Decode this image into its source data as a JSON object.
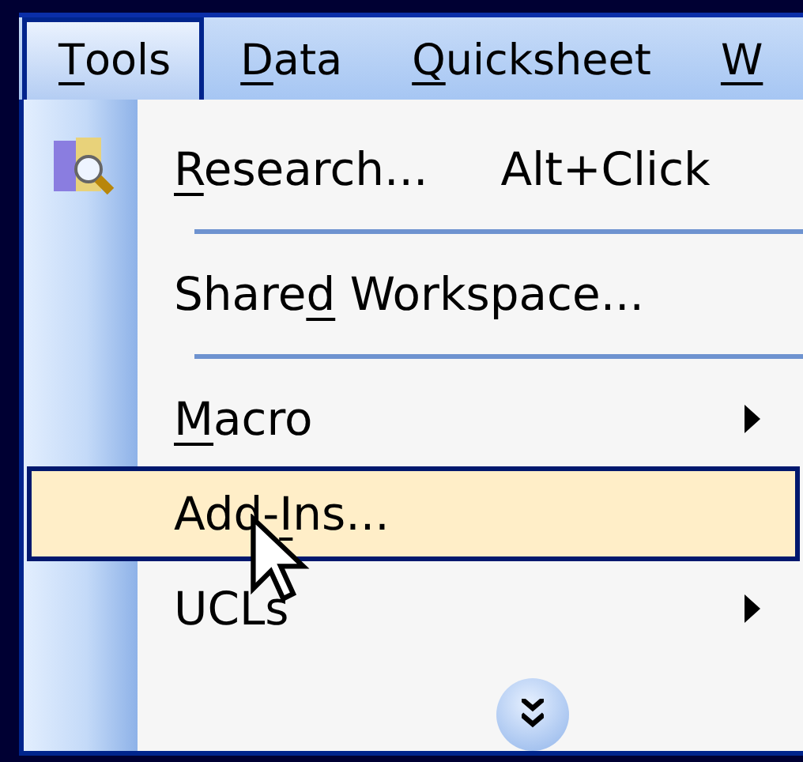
{
  "menu_bar": [
    {
      "access_key": "T",
      "label_end": "ools",
      "selected": true
    },
    {
      "access_key": "D",
      "label_end": "ata",
      "selected": false
    },
    {
      "access_key": "Q",
      "label_end": "uicksheet",
      "selected": false
    },
    {
      "access_key": "W",
      "selected": false
    }
  ],
  "menu": {
    "items": [
      {
        "kind": "command",
        "access_key": "R",
        "label_end": "esearch...",
        "shortcut": "Alt+Click",
        "has_icon": true,
        "selected": false
      },
      {
        "kind": "separator"
      },
      {
        "kind": "command",
        "label_start": "Share",
        "access_key": "d",
        "label_end": " Workspace...",
        "has_icon": false,
        "selected": false
      },
      {
        "kind": "separator"
      },
      {
        "kind": "submenu",
        "access_key": "M",
        "label_end": "acro",
        "has_icon": false,
        "selected": false
      },
      {
        "kind": "command",
        "label_start": "Add-",
        "access_key": "I",
        "label_end": "ns...",
        "has_icon": false,
        "selected": true
      },
      {
        "kind": "submenu",
        "label_start": "UCLs",
        "has_icon": false,
        "selected": false
      }
    ],
    "expand_more": true
  }
}
